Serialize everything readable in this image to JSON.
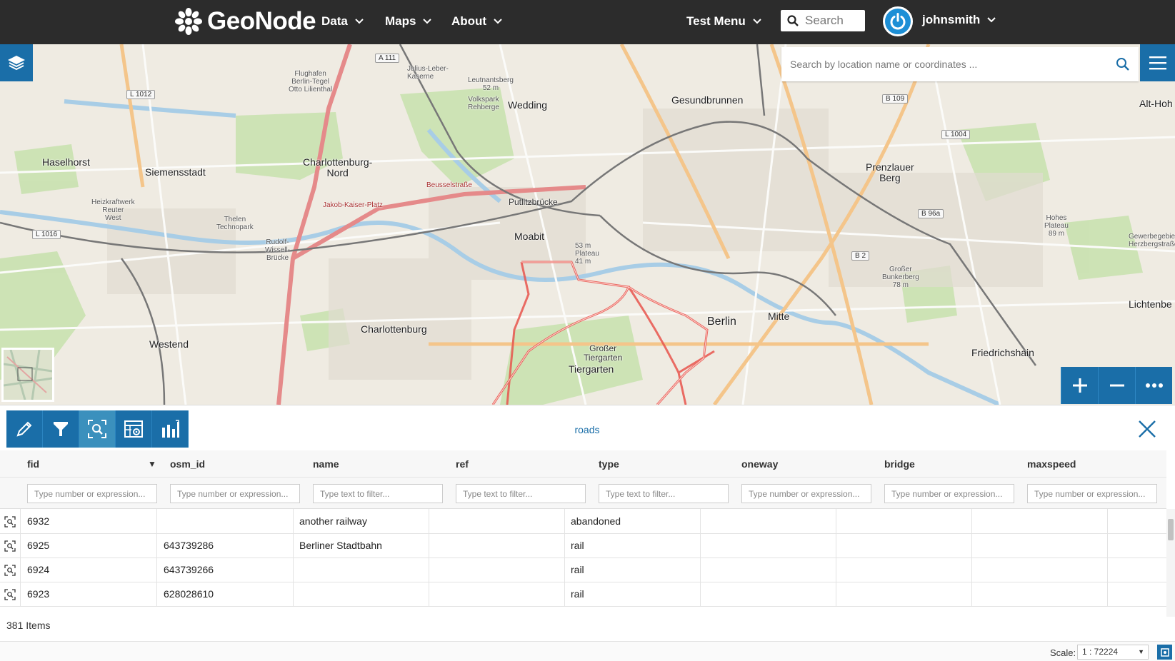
{
  "nav": {
    "brand": "GeoNode",
    "items": [
      {
        "label": "Data"
      },
      {
        "label": "Maps"
      },
      {
        "label": "About"
      }
    ],
    "test_menu": "Test Menu",
    "search_placeholder": "Search",
    "username": "johnsmith"
  },
  "map": {
    "search_placeholder": "Search by location name or coordinates ...",
    "labels": {
      "haselhorst": "Haselhorst",
      "siemensstadt": "Siemensstadt",
      "charlottenburg_nord": "Charlottenburg-\nNord",
      "wedding": "Wedding",
      "gesundbrunnen": "Gesundbrunnen",
      "prenzlauer_berg": "Prenzlauer\nBerg",
      "moabit": "Moabit",
      "putlitzbrucke": "Putlitzbrücke",
      "charlottenburg": "Charlottenburg",
      "westend": "Westend",
      "tiergarten": "Tiergarten",
      "grosser_tiergarten": "Großer\nTiergarten",
      "berlin": "Berlin",
      "mitte": "Mitte",
      "friedrichshain": "Friedrichshain",
      "lichtenberg": "Lichtenbe",
      "alt_hoh": "Alt-Hoh",
      "flughafen": "Flughafen\nBerlin-Tegel\nOtto Lilienthal",
      "thelen": "Thelen\nTechnopark",
      "rudolf": "Rudolf-\nWissell-\nBrücke",
      "jakob_kaiser": "Jakob-Kaiser-Platz",
      "beusselstrasse": "Beusselstraße",
      "julius_leber": "Julius-Leber-\nKaserne",
      "leutnantsberg": "Leutnantsberg\n52 m",
      "volkspark": "Volkspark\nRehberge",
      "grosser_bunkerberg": "Großer\nBunkerberg\n78 m",
      "hohes_plateau": "Hohes\nPlateau\n89 m",
      "gewerbegebiet": "Gewerbegebiet\nHerzbergstraße",
      "heizkraftwerk": "Heizkraftwerk\nReuter\nWest",
      "plateau": "53 m\nPlateau\n41 m"
    },
    "shields": [
      "A 111",
      "L 1012",
      "B 109",
      "L 1004",
      "B 96a",
      "B 2",
      "L 1016"
    ]
  },
  "panel": {
    "title": "roads",
    "tools": [
      "edit",
      "filter",
      "zoom-to-features",
      "settings",
      "chart"
    ]
  },
  "grid": {
    "columns": [
      {
        "key": "fid",
        "label": "fid",
        "placeholder": "Type number or expression..."
      },
      {
        "key": "osm_id",
        "label": "osm_id",
        "placeholder": "Type number or expression..."
      },
      {
        "key": "name",
        "label": "name",
        "placeholder": "Type text to filter..."
      },
      {
        "key": "ref",
        "label": "ref",
        "placeholder": "Type text to filter..."
      },
      {
        "key": "type",
        "label": "type",
        "placeholder": "Type text to filter..."
      },
      {
        "key": "oneway",
        "label": "oneway",
        "placeholder": "Type number or expression..."
      },
      {
        "key": "bridge",
        "label": "bridge",
        "placeholder": "Type number or expression..."
      },
      {
        "key": "maxspeed",
        "label": "maxspeed",
        "placeholder": "Type number or expression..."
      }
    ],
    "sort_indicator": "▼",
    "rows": [
      {
        "fid": "6932",
        "osm_id": "",
        "name": "another railway",
        "ref": "",
        "type": "abandoned",
        "oneway": "",
        "bridge": "",
        "maxspeed": ""
      },
      {
        "fid": "6925",
        "osm_id": "643739286",
        "name": "Berliner Stadtbahn",
        "ref": "",
        "type": "rail",
        "oneway": "",
        "bridge": "",
        "maxspeed": ""
      },
      {
        "fid": "6924",
        "osm_id": "643739266",
        "name": "",
        "ref": "",
        "type": "rail",
        "oneway": "",
        "bridge": "",
        "maxspeed": ""
      },
      {
        "fid": "6923",
        "osm_id": "628028610",
        "name": "",
        "ref": "",
        "type": "rail",
        "oneway": "",
        "bridge": "",
        "maxspeed": ""
      }
    ],
    "items_count": "381 Items"
  },
  "footer": {
    "scale_label": "Scale:",
    "scale_value": "1 : 72224"
  },
  "colors": {
    "nav_bg": "#2c2c2c",
    "accent": "#1a6ea8",
    "route_highlight": "#e8554e"
  }
}
